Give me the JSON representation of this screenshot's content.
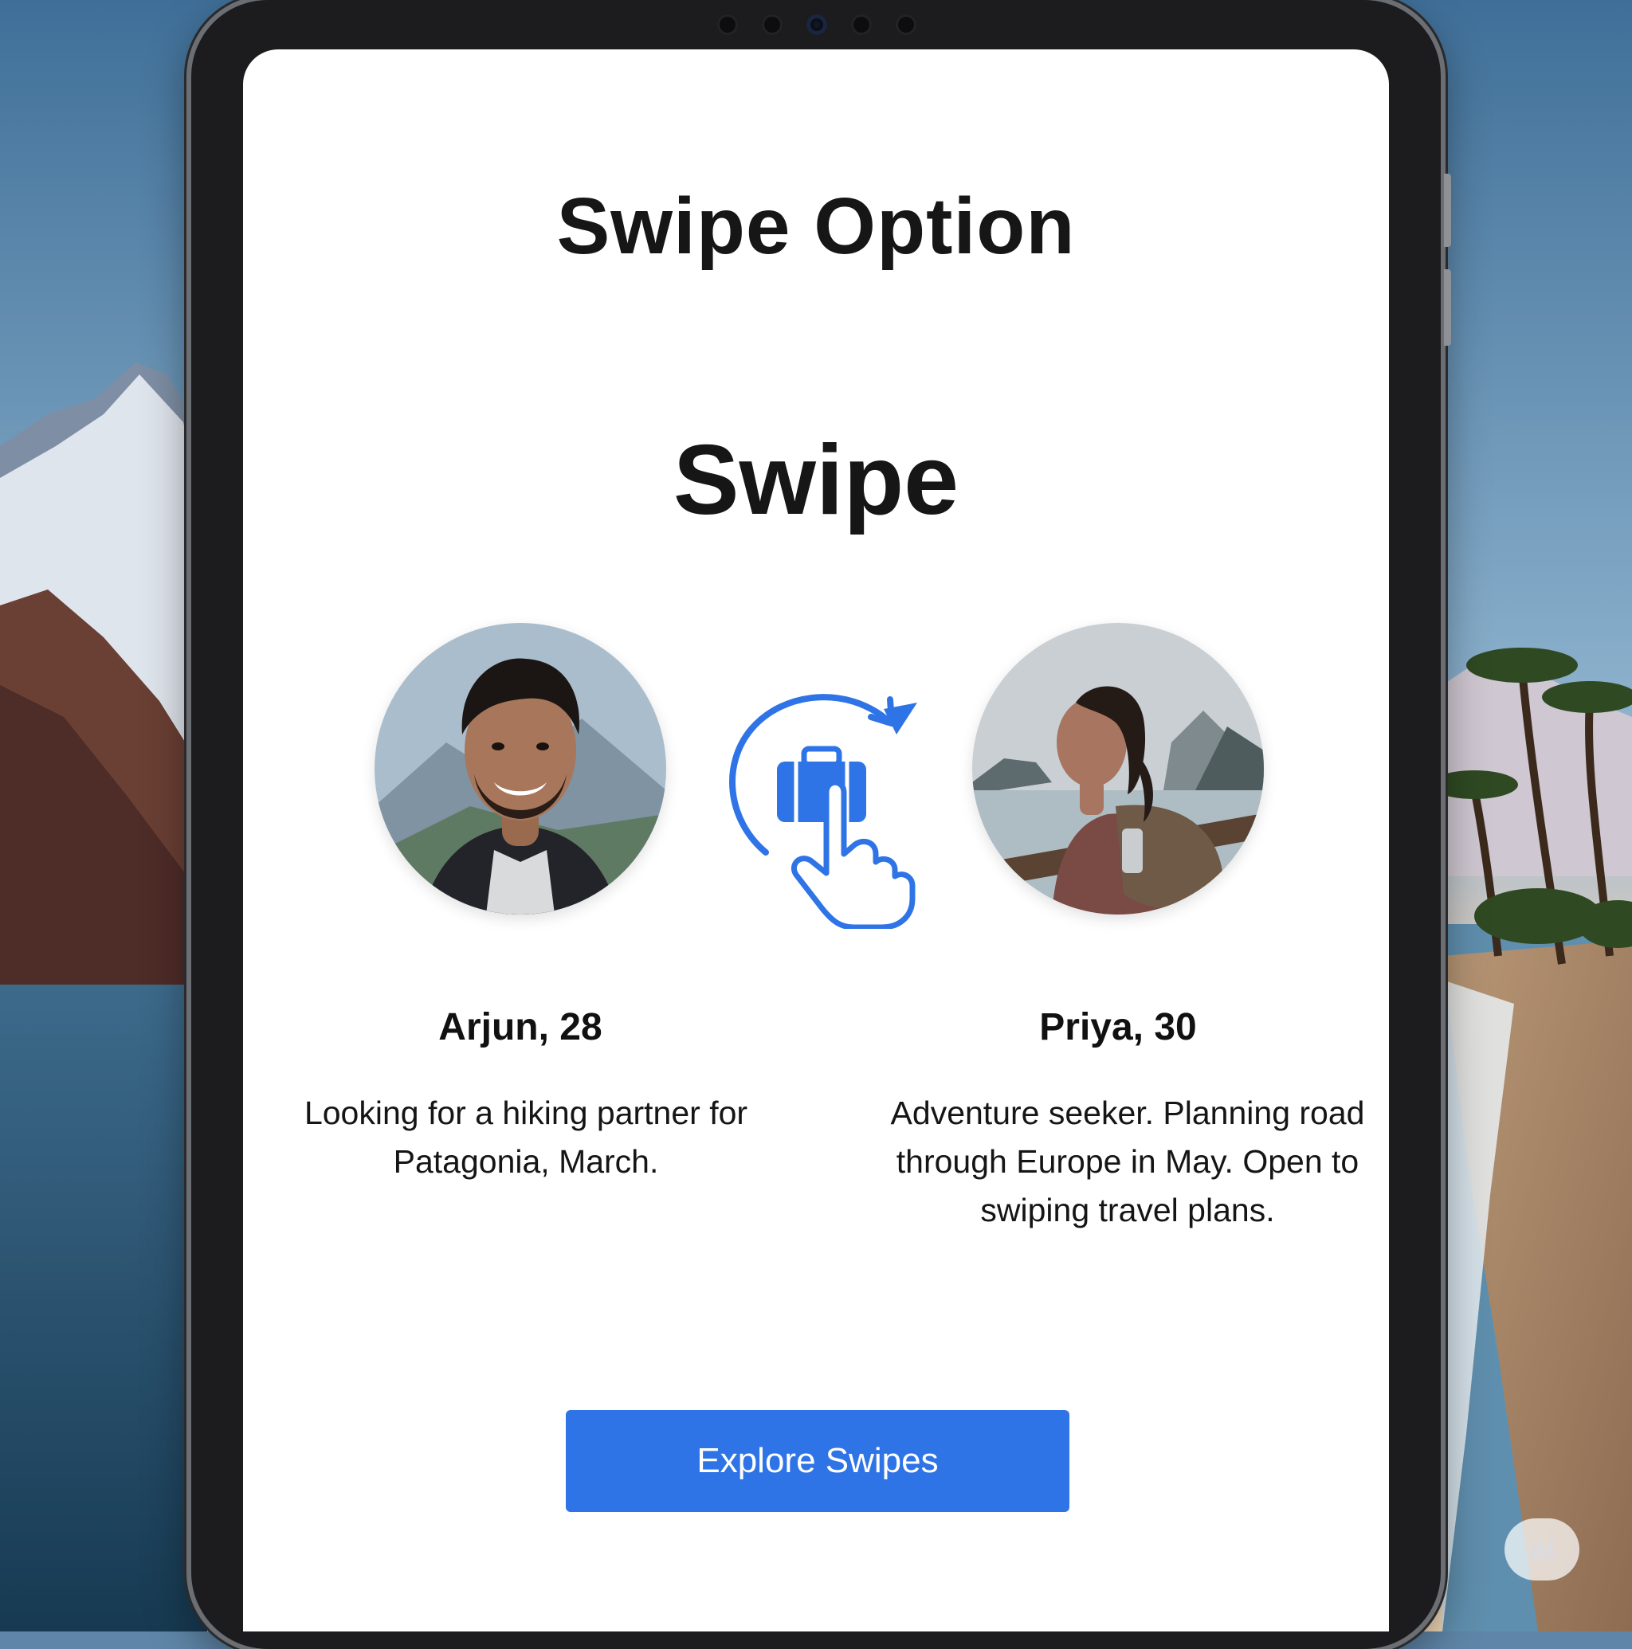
{
  "screen": {
    "title": "Swipe Option",
    "subtitle": "Swipe"
  },
  "profiles": [
    {
      "name": "Arjun, 28",
      "bio": "Looking for a hiking partner for Patagonia, March."
    },
    {
      "name": "Priya, 30",
      "bio": "Adventure seeker. Planning road through Europe in May. Open to swiping travel plans."
    }
  ],
  "swap_icon": "swipe-suitcase-hand-icon",
  "cta": {
    "label": "Explore Swipes"
  },
  "watermark": {
    "label": "ai"
  },
  "colors": {
    "accent": "#2f74e6",
    "title": "#161616",
    "screen_bg": "#ffffff"
  }
}
